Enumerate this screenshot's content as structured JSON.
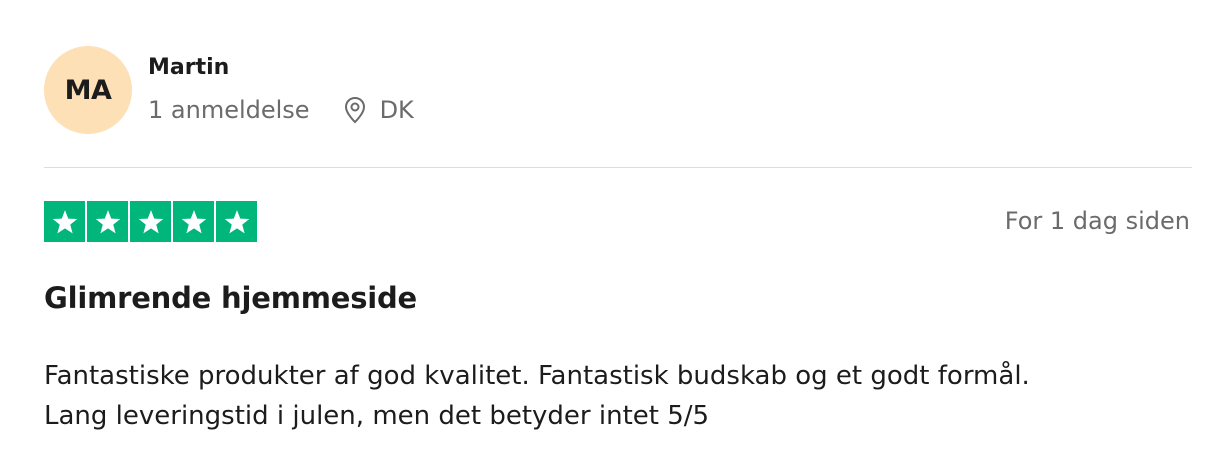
{
  "reviewer": {
    "initials": "MA",
    "name": "Martin",
    "review_count": "1 anmeldelse",
    "location_icon": "location-pin-icon",
    "country": "DK",
    "avatar_color": "#fde0b5"
  },
  "review": {
    "rating": 5,
    "max_rating": 5,
    "star_color": "#00b67a",
    "date": "For 1 dag siden",
    "title": "Glimrende hjemmeside",
    "body_lines": [
      "Fantastiske produkter af god kvalitet. Fantastisk budskab og et godt formål.",
      "Lang leveringstid i julen, men det betyder intet 5/5"
    ]
  }
}
